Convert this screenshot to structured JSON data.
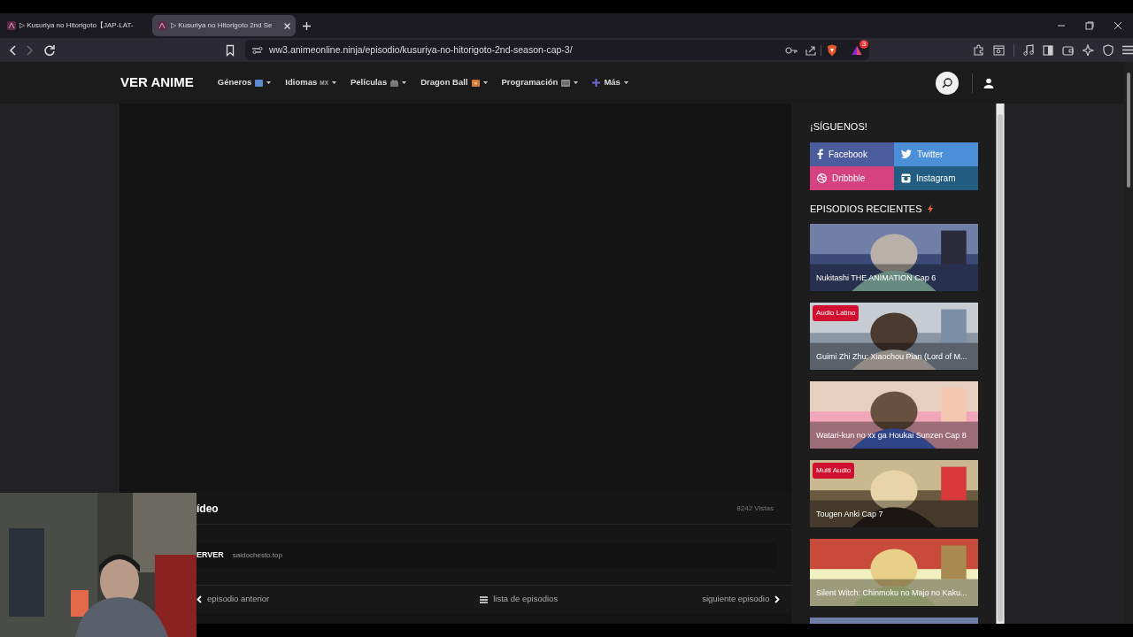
{
  "browser": {
    "tabs": [
      {
        "title": "▷ Kusuriya no Hitorigoto【JAP-LAT-",
        "selected": false
      },
      {
        "title": "▷ Kusuriya no Hitorigoto 2nd Se",
        "selected": true
      }
    ],
    "url": "ww3.animeonline.ninja/episodio/kusuriya-no-hitorigoto-2nd-season-cap-3/",
    "shields_count": "3"
  },
  "site": {
    "logo": "VER ANIME",
    "nav": [
      {
        "label": "Géneros",
        "kind": "blue"
      },
      {
        "label": "Idiomas",
        "kind": "mx",
        "suffix": "MX"
      },
      {
        "label": "Películas",
        "kind": "camera"
      },
      {
        "label": "Dragon Ball",
        "kind": "orange"
      },
      {
        "label": "Programación",
        "kind": "calendar"
      },
      {
        "label": "Más",
        "kind": "plus"
      }
    ]
  },
  "player": {
    "title": "ídeo",
    "views": "8242 Vistas",
    "server_label": "ERVER",
    "server_name": "saidochesto.top",
    "prev": "episodio anterior",
    "list": "lista de episodios",
    "next": "siguiente episodio"
  },
  "sidebar": {
    "follow_title": "¡SÍGUENOS!",
    "social": [
      {
        "label": "Facebook",
        "kind": "facebook",
        "color": "#4b5c9c"
      },
      {
        "label": "Twitter",
        "kind": "twitter",
        "color": "#4a8fd8"
      },
      {
        "label": "Dribbble",
        "kind": "dribbble",
        "color": "#d5427f"
      },
      {
        "label": "Instagram",
        "kind": "instagram",
        "color": "#225c80"
      }
    ],
    "recent_title": "EPISODIOS RECIENTES",
    "episodes": [
      {
        "title": "Nukitashi THE ANIMATION Cap 6"
      },
      {
        "title": "Guimi Zhi Zhu: Xiaochou Pian (Lord of M...",
        "badge": "Audio Latino"
      },
      {
        "title": "Watari-kun no xx ga Houkai Sunzen Cap 8"
      },
      {
        "title": "Tougen Anki Cap 7",
        "badge": "Multi Audio"
      },
      {
        "title": "Silent Witch: Chinmoku no Majo no Kaku..."
      }
    ]
  }
}
